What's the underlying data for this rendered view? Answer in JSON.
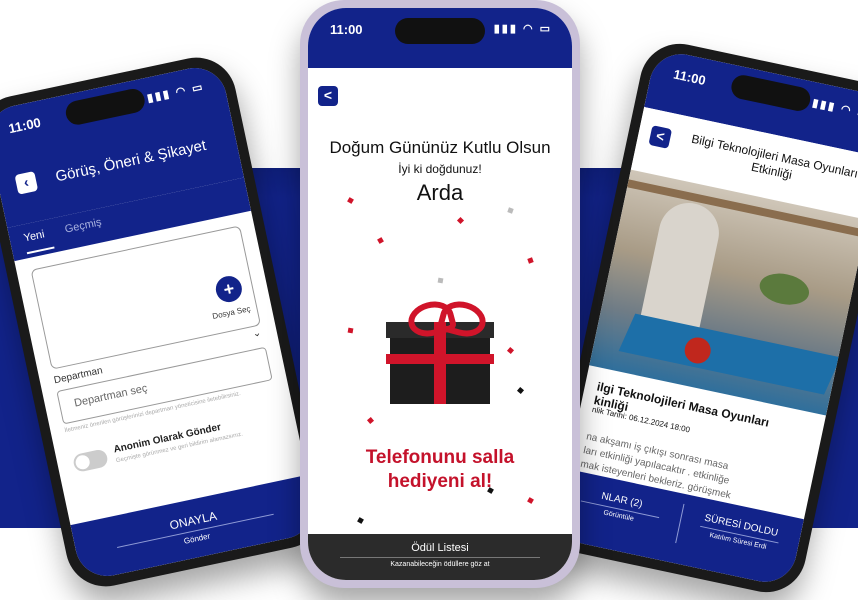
{
  "left_phone": {
    "time": "11:00",
    "status_icons": "▮▮▮ ◠ ▭",
    "title": "Görüş, Öneri & Şikayet",
    "back_icon": "chevron-left-icon",
    "tabs": [
      {
        "label": "Yeni"
      },
      {
        "label": "Geçmiş"
      }
    ],
    "add_icon": "plus-icon",
    "add_symbol": "+",
    "file_label": "Dosya Seç",
    "department_label": "Departman",
    "department_placeholder": "Departman seç",
    "department_hint": "İletmeniz önerilen görüşlerinizi departman yöneticisine iletebilirsiniz.",
    "anonymous_title": "Anonim Olarak Gönder",
    "anonymous_subtitle": "Geçmişte görünmez ve geri bildirim alamazsınız.",
    "submit_label": "ONAYLA",
    "submit_sub": "Gönder"
  },
  "center_phone": {
    "time": "11:00",
    "status_icons": "▮▮▮ ◠ ▭",
    "back_symbol": "<",
    "title": "Doğum Gününüz Kutlu Olsun",
    "subtitle": "İyi ki doğdunuz!",
    "name": "Arda",
    "shake_line1": "Telefonunu salla",
    "shake_line2": "hediyeni al!",
    "reward_title": "Ödül Listesi",
    "reward_sub": "Kazanabileceğin ödüllere göz at"
  },
  "right_phone": {
    "time": "11:00",
    "status_icons": "▮▮▮ ◠ ▭",
    "back_symbol": "<",
    "header_title": "Bilgi Teknolojileri Masa Oyunları Etkinliği",
    "event_title": "ilgi Teknolojileri Masa Oyunları\nkinliği",
    "event_date": "nlik Tarihi: 06.12.2024  18:00",
    "event_description": "na akşamı iş çıkışı sonrası masa\nları etkinliği yapılacaktır . etkinliğe\nmak isteyenleri bekleriz. görüşmek",
    "left_action_title": "NLAR (2)",
    "left_action_sub": "Görüntüle",
    "right_action_title": "SÜRESİ DOLDU",
    "right_action_sub": "Katılım Süresi Erdi"
  },
  "colors": {
    "brand_blue": "#12238a",
    "accent_red": "#c4122b",
    "dark_bar": "#2b2b2b"
  }
}
